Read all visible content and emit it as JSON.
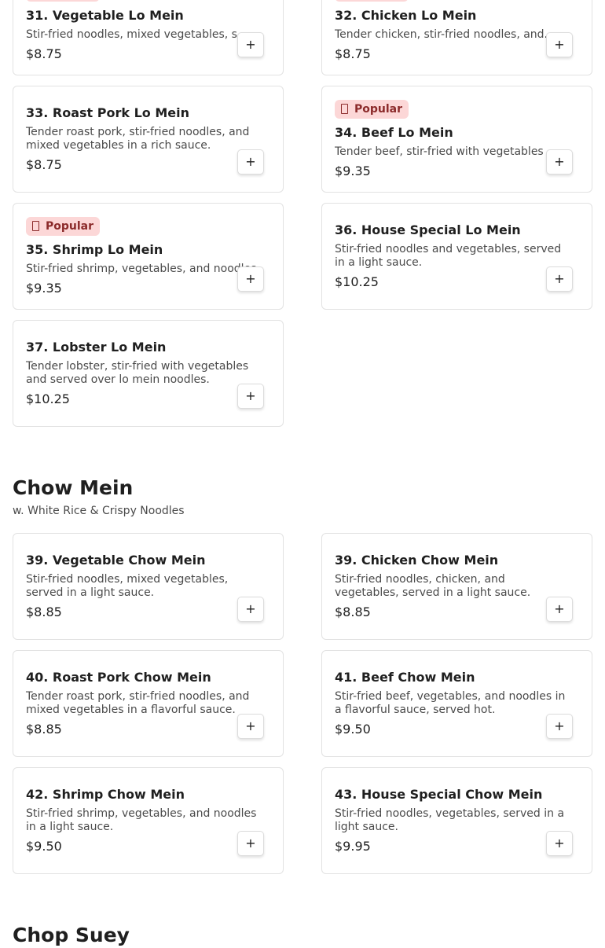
{
  "popular_label": "Popular",
  "add_symbol": "+",
  "lo_mein_items": [
    {
      "name": "31. Vegetable Lo Mein",
      "desc": "Stir-fried noodles, mixed vegetables, s...",
      "price": "$8.75"
    },
    {
      "name": "32. Chicken Lo Mein",
      "desc": "Tender chicken, stir-fried noodles, and...",
      "price": "$8.75"
    },
    {
      "name": "33. Roast Pork Lo Mein",
      "desc": "Tender roast pork, stir-fried noodles, and mixed vegetables in a rich sauce.",
      "price": "$8.75"
    },
    {
      "name": "34. Beef Lo Mein",
      "desc": "Tender beef, stir-fried with vegetables ...",
      "price": "$9.35"
    },
    {
      "name": "35. Shrimp Lo Mein",
      "desc": "Stir-fried shrimp, vegetables, and noodles.",
      "price": "$9.35"
    },
    {
      "name": "36. House Special Lo Mein",
      "desc": "Stir-fried noodles and vegetables, served in a light sauce.",
      "price": "$10.25"
    },
    {
      "name": "37. Lobster Lo Mein",
      "desc": "Tender lobster, stir-fried with vegetables and served over lo mein noodles.",
      "price": "$10.25"
    }
  ],
  "chow_mein": {
    "title": "Chow Mein",
    "subtitle": "w. White Rice & Crispy Noodles",
    "items": [
      {
        "name": "39. Vegetable Chow Mein",
        "desc": "Stir-fried noodles, mixed vegetables, served in a light sauce.",
        "price": "$8.85"
      },
      {
        "name": "39. Chicken Chow Mein",
        "desc": "Stir-fried noodles, chicken, and vegetables, served in a light sauce.",
        "price": "$8.85"
      },
      {
        "name": "40. Roast Pork Chow Mein",
        "desc": "Tender roast pork, stir-fried noodles, and mixed vegetables in a flavorful sauce.",
        "price": "$8.85"
      },
      {
        "name": "41. Beef Chow Mein",
        "desc": "Stir-fried beef, vegetables, and noodles in a flavorful sauce, served hot.",
        "price": "$9.50"
      },
      {
        "name": "42. Shrimp Chow Mein",
        "desc": "Stir-fried shrimp, vegetables, and noodles in a light sauce.",
        "price": "$9.50"
      },
      {
        "name": "43. House Special Chow Mein",
        "desc": "Stir-fried noodles, vegetables, served in a light sauce.",
        "price": "$9.95"
      }
    ]
  },
  "chop_suey": {
    "title": "Chop Suey"
  }
}
